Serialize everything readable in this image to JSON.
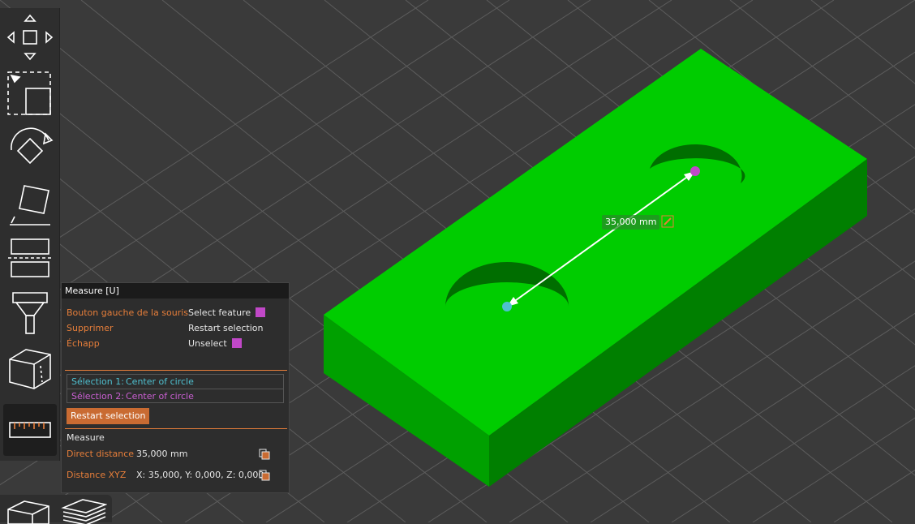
{
  "toolbar": {
    "tools": [
      "move-icon",
      "scale-icon",
      "rotate-icon",
      "place-on-face-icon",
      "cut-icon",
      "paint-icon",
      "seam-icon",
      "measure-icon"
    ],
    "active": "measure-icon"
  },
  "panel": {
    "title": "Measure [U]",
    "shortcuts": [
      {
        "key": "Bouton gauche de la souris",
        "action": "Select feature"
      },
      {
        "key": "Supprimer",
        "action": "Restart selection"
      },
      {
        "key": "Échapp",
        "action": "Unselect"
      }
    ],
    "selections": [
      {
        "label": "Sélection 1:",
        "value": "Center of circle"
      },
      {
        "label": "Sélection 2:",
        "value": "Center of circle"
      }
    ],
    "restart_button": "Restart selection",
    "measure_title": "Measure",
    "direct_distance_label": "Direct distance",
    "direct_distance_value": "35,000 mm",
    "distance_xyz_label": "Distance XYZ",
    "distance_xyz_value": "X: 35,000, Y: 0,000, Z: 0,000"
  },
  "scene": {
    "dimension_label": "35,000 mm",
    "model_color": "#00cc00",
    "selection1_color": "#4fc0d0",
    "selection2_color": "#c148c8"
  }
}
